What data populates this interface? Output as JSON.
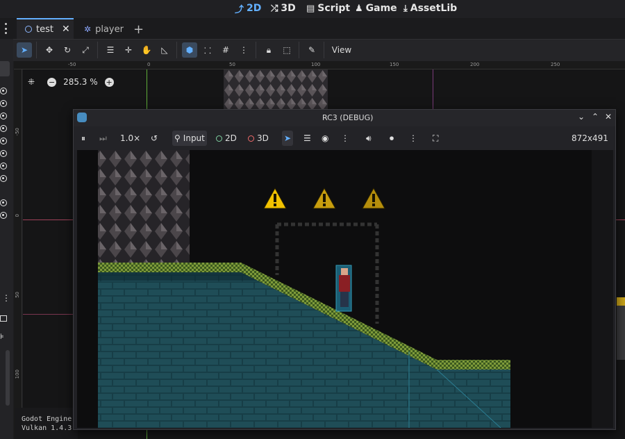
{
  "workspaces": [
    {
      "label": "2D",
      "icon": "2d-icon",
      "active": true
    },
    {
      "label": "3D",
      "icon": "3d-icon",
      "active": false
    },
    {
      "label": "Script",
      "icon": "script-icon",
      "active": false
    },
    {
      "label": "Game",
      "icon": "game-icon",
      "active": false
    },
    {
      "label": "AssetLib",
      "icon": "assetlib-icon",
      "active": false
    }
  ],
  "scene_tabs": [
    {
      "label": "test",
      "active": true
    },
    {
      "label": "player",
      "active": false
    }
  ],
  "editor_toolbar": {
    "view_label": "View"
  },
  "zoom": {
    "value": "285.3 %"
  },
  "ruler_h": [
    "-50",
    "0",
    "50",
    "100",
    "150",
    "200",
    "250"
  ],
  "ruler_v": [
    "-50",
    "0",
    "50",
    "100"
  ],
  "debug_window": {
    "title": "RC3 (DEBUG)",
    "speed": "1.0×",
    "input_label": "Input",
    "mode_2d": "2D",
    "mode_3d": "3D",
    "resolution": "872x491"
  },
  "console": {
    "line1": "Godot Engine",
    "line2": "Vulkan 1.4.3"
  },
  "colors": {
    "accent": "#63b0ff",
    "warning_yellow": "#f2c200",
    "tile_teal": "#1e4c56",
    "grass_green": "#5c7a2a"
  }
}
